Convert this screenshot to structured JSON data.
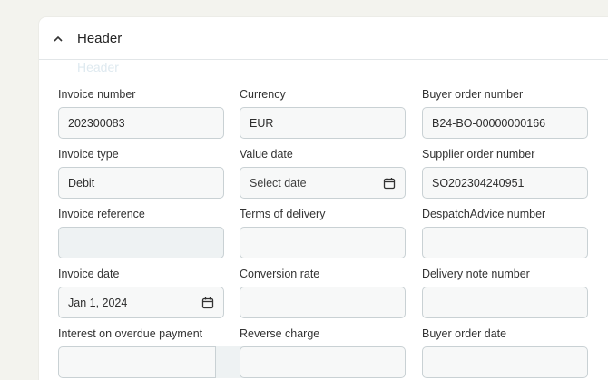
{
  "section": {
    "title": "Header",
    "ghost_text": "Header"
  },
  "fields": {
    "invoice_number": {
      "label": "Invoice number",
      "value": "202300083"
    },
    "currency": {
      "label": "Currency",
      "value": "EUR"
    },
    "buyer_order_number": {
      "label": "Buyer order number",
      "value": "B24-BO-00000000166"
    },
    "invoice_type": {
      "label": "Invoice type",
      "value": "Debit"
    },
    "value_date": {
      "label": "Value date",
      "placeholder": "Select date"
    },
    "supplier_order_number": {
      "label": "Supplier order number",
      "value": "SO202304240951"
    },
    "invoice_reference": {
      "label": "Invoice reference",
      "value": ""
    },
    "terms_of_delivery": {
      "label": "Terms of delivery",
      "value": ""
    },
    "despatch_advice_number": {
      "label": "DespatchAdvice number",
      "value": ""
    },
    "invoice_date": {
      "label": "Invoice date",
      "value": "Jan 1, 2024"
    },
    "conversion_rate": {
      "label": "Conversion rate",
      "value": ""
    },
    "delivery_note_number": {
      "label": "Delivery note number",
      "value": ""
    },
    "interest_on_overdue_payment": {
      "label": "Interest on overdue payment"
    },
    "reverse_charge": {
      "label": "Reverse charge"
    },
    "buyer_order_date": {
      "label": "Buyer order date"
    }
  },
  "icons": {
    "collapse": "chevron-up-icon",
    "calendar": "calendar-icon"
  }
}
